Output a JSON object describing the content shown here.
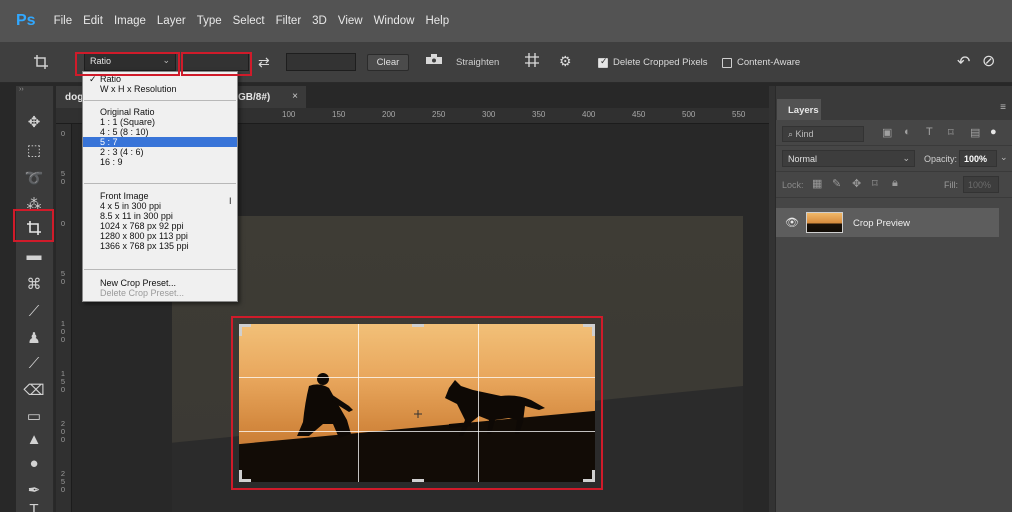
{
  "app": {
    "logo": "Ps",
    "menu": [
      "File",
      "Edit",
      "Image",
      "Layer",
      "Type",
      "Select",
      "Filter",
      "3D",
      "View",
      "Window",
      "Help"
    ]
  },
  "options_bar": {
    "ratio_value": "Ratio",
    "clear_label": "Clear",
    "straighten_label": "Straighten",
    "delete_cropped_label": "Delete Cropped Pixels",
    "delete_cropped_checked": true,
    "content_aware_label": "Content-Aware",
    "content_aware_checked": false
  },
  "document": {
    "tab_prefix": "dog",
    "tab_suffix": "GB/8#)",
    "close": "×",
    "ruler_ticks": [
      "100",
      "150",
      "200",
      "250",
      "300",
      "350",
      "400",
      "450",
      "500",
      "550"
    ],
    "left_ruler": [
      "0",
      "5 0",
      "0",
      "5 0",
      "1 0 0",
      "1 5 0",
      "2 0 0",
      "2 5 0"
    ]
  },
  "ratio_dropdown": {
    "items": [
      {
        "label": "Ratio",
        "checked": true
      },
      {
        "label": "W x H x Resolution"
      },
      {
        "label": "Original Ratio"
      },
      {
        "label": "1 : 1 (Square)"
      },
      {
        "label": "4 : 5 (8 : 10)"
      },
      {
        "label": "5 : 7",
        "selected": true
      },
      {
        "label": "2 : 3 (4 : 6)"
      },
      {
        "label": "16 : 9"
      },
      {
        "label": "Front Image"
      },
      {
        "label": "4 x 5 in 300 ppi"
      },
      {
        "label": "8.5 x 11 in 300 ppi"
      },
      {
        "label": "1024 x 768 px 92 ppi"
      },
      {
        "label": "1280 x 800 px 113 ppi"
      },
      {
        "label": "1366 x 768 px 135 ppi"
      },
      {
        "label": "New Crop Preset..."
      },
      {
        "label": "Delete Crop Preset...",
        "disabled": true
      }
    ],
    "cursor": "I"
  },
  "layers_panel": {
    "tab": "Layers",
    "kind_label": "Kind",
    "blend_mode": "Normal",
    "opacity_label": "Opacity:",
    "opacity_value": "100%",
    "lock_label": "Lock:",
    "fill_label": "Fill:",
    "fill_value": "100%",
    "layer_name": "Crop Preview"
  },
  "colors": {
    "highlight": "#d01b2a",
    "selection": "#3874d8",
    "ps_blue": "#31a8ff"
  }
}
